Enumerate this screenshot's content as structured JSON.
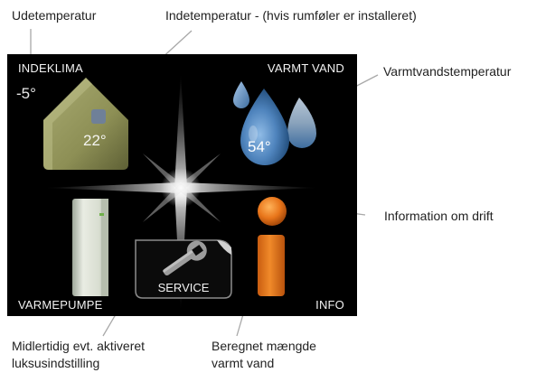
{
  "callouts": {
    "udetemperatur": "Udetemperatur",
    "indetemperatur": "Indetemperatur - (hvis rumføler er installeret)",
    "varmtvandstemperatur": "Varmtvandstemperatur",
    "information": "Information om drift",
    "luksus_line1": "Midlertidig evt. aktiveret",
    "luksus_line2": "luksusindstilling",
    "beregnet_line1": "Beregnet mængde",
    "beregnet_line2": "varmt vand"
  },
  "screen": {
    "indeklima": {
      "label": "INDEKLIMA",
      "outdoor_temp": "-5°",
      "indoor_temp": "22°"
    },
    "varmt_vand": {
      "label": "VARMT VAND",
      "temperature": "54°"
    },
    "varmepumpe": {
      "label": "VARMEPUMPE"
    },
    "service": {
      "label": "SERVICE"
    },
    "info": {
      "label": "INFO"
    }
  },
  "colors": {
    "screen_bg": "#000000",
    "house": "#8d8f55",
    "water_drop": "#4f84bd",
    "info_icon": "#e8751a",
    "leader_line": "#a8a8a8"
  },
  "icons": {
    "indeklima": "house-icon",
    "varmt_vand": "water-drops-icon",
    "varmepumpe": "heat-pump-icon",
    "service": "wrench-icon",
    "info": "info-icon",
    "center": "star-divider-icon"
  }
}
